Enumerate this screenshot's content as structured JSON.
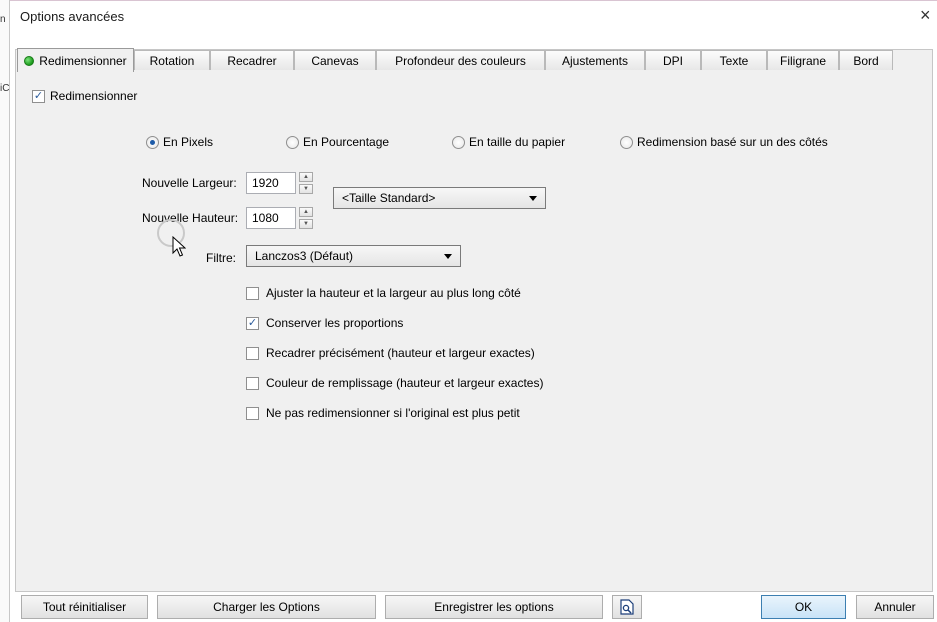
{
  "window": {
    "title": "Options avancées",
    "close_glyph": "×"
  },
  "left_strip": {
    "chars": [
      "n",
      "iC"
    ]
  },
  "tabs": [
    {
      "label": "Redimensionner",
      "active": true
    },
    {
      "label": "Rotation"
    },
    {
      "label": "Recadrer"
    },
    {
      "label": "Canevas"
    },
    {
      "label": "Profondeur des couleurs"
    },
    {
      "label": "Ajustements"
    },
    {
      "label": "DPI"
    },
    {
      "label": "Texte"
    },
    {
      "label": "Filigrane"
    },
    {
      "label": "Bord"
    }
  ],
  "resize": {
    "enable_label": "Redimensionner",
    "enable_checked": true,
    "modes": [
      {
        "label": "En Pixels",
        "selected": true
      },
      {
        "label": "En Pourcentage",
        "selected": false
      },
      {
        "label": "En taille du papier",
        "selected": false
      },
      {
        "label": "Redimension basé sur un des côtés",
        "selected": false
      }
    ],
    "width_label": "Nouvelle Largeur:",
    "width_value": "1920",
    "height_label": "Nouvelle Hauteur:",
    "height_value": "1080",
    "standard_size": "<Taille Standard>",
    "filter_label": "Filtre:",
    "filter_value": "Lanczos3 (Défaut)",
    "options": [
      {
        "label": "Ajuster la hauteur et la largeur au plus long côté",
        "checked": false
      },
      {
        "label": "Conserver les proportions",
        "checked": true
      },
      {
        "label": "Recadrer précisément (hauteur et largeur exactes)",
        "checked": false
      },
      {
        "label": "Couleur de remplissage (hauteur et largeur exactes)",
        "checked": false
      },
      {
        "label": "Ne pas redimensionner si l'original est plus petit",
        "checked": false
      }
    ]
  },
  "footer": {
    "reset": "Tout réinitialiser",
    "load": "Charger les Options",
    "save": "Enregistrer les options",
    "preview_icon": "preview-icon",
    "ok": "OK",
    "cancel": "Annuler"
  },
  "colors": {
    "accent": "#1d5ba8",
    "active_dot": "#1a9a1a"
  }
}
